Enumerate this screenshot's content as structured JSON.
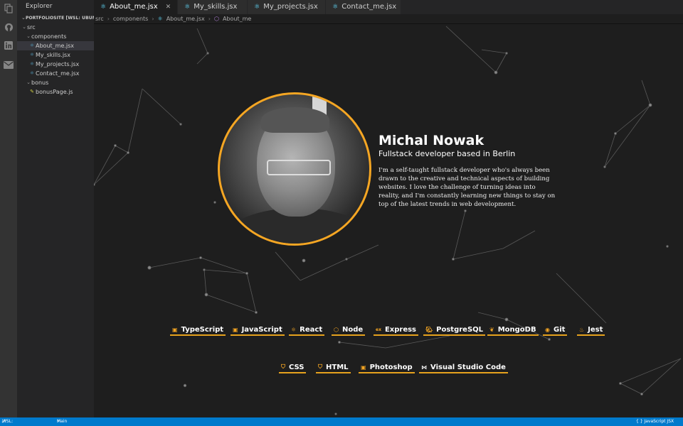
{
  "sidebar": {
    "title": "Explorer",
    "project": "PORTFOLIOSITE [WSL: UBUNTU]",
    "items": [
      {
        "label": "src",
        "type": "folder"
      },
      {
        "label": "components",
        "type": "folder"
      },
      {
        "label": "About_me.jsx",
        "type": "react"
      },
      {
        "label": "My_skills.jsx",
        "type": "react"
      },
      {
        "label": "My_projects.jsx",
        "type": "react"
      },
      {
        "label": "Contact_me.jsx",
        "type": "react"
      },
      {
        "label": "bonus",
        "type": "folder"
      },
      {
        "label": "bonusPage.js",
        "type": "js"
      }
    ]
  },
  "tabs": [
    {
      "label": "About_me.jsx",
      "active": true
    },
    {
      "label": "My_skills.jsx",
      "active": false
    },
    {
      "label": "My_projects.jsx",
      "active": false
    },
    {
      "label": "Contact_me.jsx",
      "active": false
    }
  ],
  "breadcrumb": [
    "src",
    "components",
    "About_me.jsx",
    "About_me"
  ],
  "profile": {
    "name": "Michal Nowak",
    "tagline": "Fullstack developer based in Berlin",
    "bio": "I'm a self-taught fullstack developer who's always been drawn to the creative and technical aspects of building websites. I love the challenge of turning ideas into reality, and I'm constantly learning new things to stay on top of the latest trends in web development."
  },
  "skills_row1": [
    "TypeScript",
    "JavaScript",
    "React",
    "Node",
    "Express",
    "PostgreSQL",
    "MongoDB",
    "Git",
    "Jest"
  ],
  "skills_row2": [
    "CSS",
    "HTML",
    "Photoshop",
    "Visual Studio Code"
  ],
  "status": {
    "remote": "WSL: Ubuntu",
    "branch": "Main",
    "language": "{ } JavaScript JSX"
  },
  "colors": {
    "accent": "#f5a623",
    "statusbar": "#007acc",
    "react": "#61dafb"
  }
}
